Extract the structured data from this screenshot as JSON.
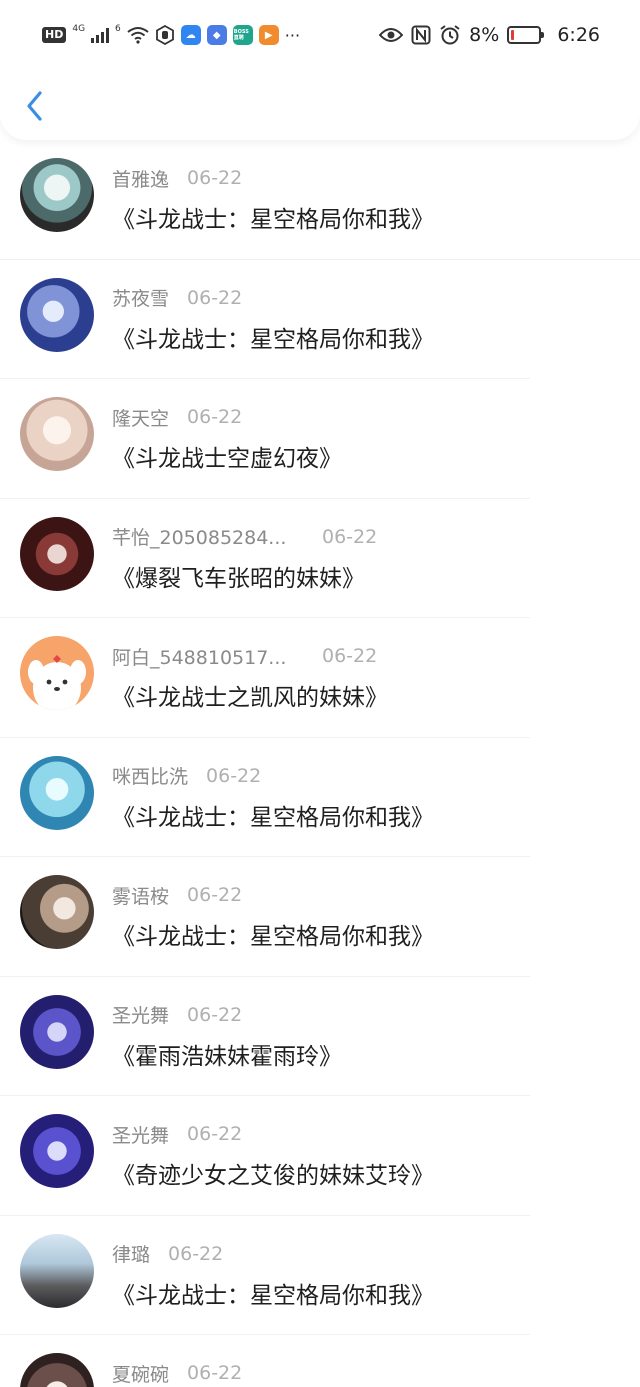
{
  "status_bar": {
    "hd_label": "HD",
    "network_label": "4G",
    "wifi_label": "6",
    "boss_label": "BOSS直聘",
    "more_label": "···",
    "battery_percent": "8%",
    "battery_level": 0.08,
    "time": "6:26"
  },
  "colors": {
    "accent": "#3a8ee6",
    "battery_low": "#e53935"
  },
  "items": [
    {
      "username": "首雅逸",
      "date": "06-22",
      "title": "《斗龙战士：星空格局你和我》"
    },
    {
      "username": "苏夜雪",
      "date": "06-22",
      "title": "《斗龙战士：星空格局你和我》"
    },
    {
      "username": "隆天空",
      "date": "06-22",
      "title": "《斗龙战士空虚幻夜》"
    },
    {
      "username": "芊怡_205085284...",
      "date": "06-22",
      "title": "《爆裂飞车张昭的妹妹》"
    },
    {
      "username": "阿白_548810517...",
      "date": "06-22",
      "title": "《斗龙战士之凯风的妹妹》"
    },
    {
      "username": "咪西比洗",
      "date": "06-22",
      "title": "《斗龙战士：星空格局你和我》"
    },
    {
      "username": "雾语桉",
      "date": "06-22",
      "title": "《斗龙战士：星空格局你和我》"
    },
    {
      "username": "圣光舞",
      "date": "06-22",
      "title": "《霍雨浩妹妹霍雨玲》"
    },
    {
      "username": "圣光舞",
      "date": "06-22",
      "title": "《奇迹少女之艾俊的妹妹艾玲》"
    },
    {
      "username": "律璐",
      "date": "06-22",
      "title": "《斗龙战士：星空格局你和我》"
    },
    {
      "username": "夏碗碗",
      "date": "06-22",
      "title": ""
    }
  ]
}
